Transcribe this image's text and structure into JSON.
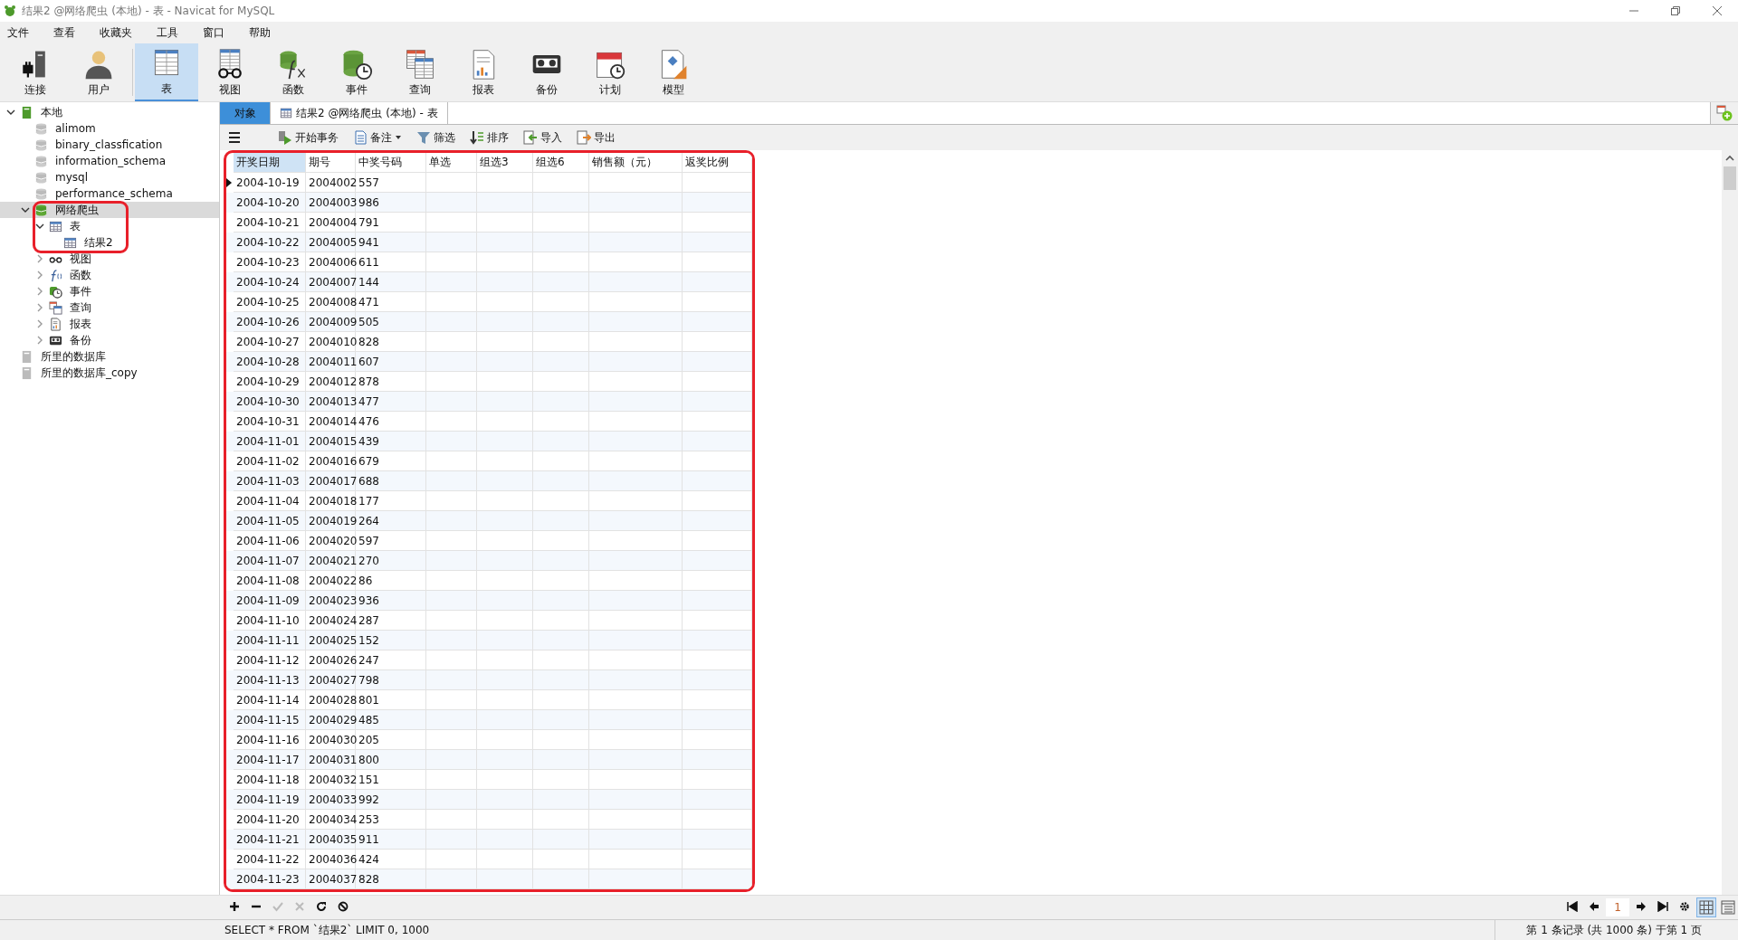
{
  "window": {
    "title": "结果2 @网络爬虫 (本地) - 表 - Navicat for MySQL"
  },
  "menu": [
    "文件",
    "查看",
    "收藏夹",
    "工具",
    "窗口",
    "帮助"
  ],
  "toolbar": [
    {
      "label": "连接",
      "selected": false
    },
    {
      "label": "用户",
      "selected": false
    },
    {
      "label": "表",
      "selected": true
    },
    {
      "label": "视图",
      "selected": false
    },
    {
      "label": "函数",
      "selected": false
    },
    {
      "label": "事件",
      "selected": false
    },
    {
      "label": "查询",
      "selected": false
    },
    {
      "label": "报表",
      "selected": false
    },
    {
      "label": "备份",
      "selected": false
    },
    {
      "label": "计划",
      "selected": false
    },
    {
      "label": "模型",
      "selected": false
    }
  ],
  "sidebar": {
    "tree": [
      {
        "label": "本地",
        "kind": "server",
        "open": true,
        "expanded": true,
        "selected": false,
        "children": [
          {
            "label": "alimom",
            "kind": "database",
            "open": false,
            "selected": false
          },
          {
            "label": "binary_classfication",
            "kind": "database",
            "open": false,
            "selected": false
          },
          {
            "label": "information_schema",
            "kind": "database",
            "open": false,
            "selected": false
          },
          {
            "label": "mysql",
            "kind": "database",
            "open": false,
            "selected": false
          },
          {
            "label": "performance_schema",
            "kind": "database",
            "open": false,
            "selected": false
          },
          {
            "label": "网络爬虫",
            "kind": "database",
            "open": true,
            "expanded": true,
            "selected": true,
            "children": [
              {
                "label": "表",
                "kind": "tables",
                "expanded": true,
                "selected": false,
                "children": [
                  {
                    "label": "结果2",
                    "kind": "table",
                    "selected": false
                  }
                ]
              },
              {
                "label": "视图",
                "kind": "views",
                "expanded": false,
                "selected": false
              },
              {
                "label": "函数",
                "kind": "functions",
                "expanded": false,
                "selected": false
              },
              {
                "label": "事件",
                "kind": "events",
                "expanded": false,
                "selected": false
              },
              {
                "label": "查询",
                "kind": "queries",
                "expanded": false,
                "selected": false
              },
              {
                "label": "报表",
                "kind": "reports",
                "expanded": false,
                "selected": false
              },
              {
                "label": "备份",
                "kind": "backups",
                "expanded": false,
                "selected": false
              }
            ]
          }
        ]
      },
      {
        "label": "所里的数据库",
        "kind": "server",
        "open": false,
        "selected": false
      },
      {
        "label": "所里的数据库_copy",
        "kind": "server",
        "open": false,
        "selected": false
      }
    ]
  },
  "tabs": [
    {
      "label": "对象",
      "selected": true
    },
    {
      "label": "结果2 @网络爬虫 (本地) - 表",
      "selected": false
    }
  ],
  "actions": [
    {
      "label": "开始事务",
      "dropdown": false
    },
    {
      "label": "备注",
      "dropdown": true
    },
    {
      "label": "筛选",
      "dropdown": false
    },
    {
      "label": "排序",
      "dropdown": false
    },
    {
      "label": "导入",
      "dropdown": false
    },
    {
      "label": "导出",
      "dropdown": false
    }
  ],
  "table": {
    "columns": [
      {
        "label": "开奖日期",
        "selected": true
      },
      {
        "label": "期号",
        "selected": false
      },
      {
        "label": "中奖号码",
        "selected": false
      },
      {
        "label": "单选",
        "selected": false
      },
      {
        "label": "组选3",
        "selected": false
      },
      {
        "label": "组选6",
        "selected": false
      },
      {
        "label": "销售额（元）",
        "selected": false
      },
      {
        "label": "返奖比例",
        "selected": false
      }
    ],
    "rows": [
      {
        "cells": [
          "2004-10-19",
          "2004002",
          "557"
        ],
        "current": true
      },
      {
        "cells": [
          "2004-10-20",
          "2004003",
          "986"
        ],
        "current": false
      },
      {
        "cells": [
          "2004-10-21",
          "2004004",
          "791"
        ],
        "current": false
      },
      {
        "cells": [
          "2004-10-22",
          "2004005",
          "941"
        ],
        "current": false
      },
      {
        "cells": [
          "2004-10-23",
          "2004006",
          "611"
        ],
        "current": false
      },
      {
        "cells": [
          "2004-10-24",
          "2004007",
          "144"
        ],
        "current": false
      },
      {
        "cells": [
          "2004-10-25",
          "2004008",
          "471"
        ],
        "current": false
      },
      {
        "cells": [
          "2004-10-26",
          "2004009",
          "505"
        ],
        "current": false
      },
      {
        "cells": [
          "2004-10-27",
          "2004010",
          "828"
        ],
        "current": false
      },
      {
        "cells": [
          "2004-10-28",
          "2004011",
          "607"
        ],
        "current": false
      },
      {
        "cells": [
          "2004-10-29",
          "2004012",
          "878"
        ],
        "current": false
      },
      {
        "cells": [
          "2004-10-30",
          "2004013",
          "477"
        ],
        "current": false
      },
      {
        "cells": [
          "2004-10-31",
          "2004014",
          "476"
        ],
        "current": false
      },
      {
        "cells": [
          "2004-11-01",
          "2004015",
          "439"
        ],
        "current": false
      },
      {
        "cells": [
          "2004-11-02",
          "2004016",
          "679"
        ],
        "current": false
      },
      {
        "cells": [
          "2004-11-03",
          "2004017",
          "688"
        ],
        "current": false
      },
      {
        "cells": [
          "2004-11-04",
          "2004018",
          "177"
        ],
        "current": false
      },
      {
        "cells": [
          "2004-11-05",
          "2004019",
          "264"
        ],
        "current": false
      },
      {
        "cells": [
          "2004-11-06",
          "2004020",
          "597"
        ],
        "current": false
      },
      {
        "cells": [
          "2004-11-07",
          "2004021",
          "270"
        ],
        "current": false
      },
      {
        "cells": [
          "2004-11-08",
          "2004022",
          "86"
        ],
        "current": false
      },
      {
        "cells": [
          "2004-11-09",
          "2004023",
          "936"
        ],
        "current": false
      },
      {
        "cells": [
          "2004-11-10",
          "2004024",
          "287"
        ],
        "current": false
      },
      {
        "cells": [
          "2004-11-11",
          "2004025",
          "152"
        ],
        "current": false
      },
      {
        "cells": [
          "2004-11-12",
          "2004026",
          "247"
        ],
        "current": false
      },
      {
        "cells": [
          "2004-11-13",
          "2004027",
          "798"
        ],
        "current": false
      },
      {
        "cells": [
          "2004-11-14",
          "2004028",
          "801"
        ],
        "current": false
      },
      {
        "cells": [
          "2004-11-15",
          "2004029",
          "485"
        ],
        "current": false
      },
      {
        "cells": [
          "2004-11-16",
          "2004030",
          "205"
        ],
        "current": false
      },
      {
        "cells": [
          "2004-11-17",
          "2004031",
          "800"
        ],
        "current": false
      },
      {
        "cells": [
          "2004-11-18",
          "2004032",
          "151"
        ],
        "current": false
      },
      {
        "cells": [
          "2004-11-19",
          "2004033",
          "992"
        ],
        "current": false
      },
      {
        "cells": [
          "2004-11-20",
          "2004034",
          "253"
        ],
        "current": false
      },
      {
        "cells": [
          "2004-11-21",
          "2004035",
          "911"
        ],
        "current": false
      },
      {
        "cells": [
          "2004-11-22",
          "2004036",
          "424"
        ],
        "current": false
      },
      {
        "cells": [
          "2004-11-23",
          "2004037",
          "828"
        ],
        "current": false
      }
    ]
  },
  "edit_buttons": [
    {
      "disabled": false
    },
    {
      "disabled": false
    },
    {
      "disabled": true
    },
    {
      "disabled": true
    },
    {
      "disabled": false
    },
    {
      "disabled": false
    }
  ],
  "pager": {
    "page": "1"
  },
  "view_buttons": [
    {
      "selected": true
    },
    {
      "selected": false
    }
  ],
  "status_bar": {
    "query": "SELECT * FROM `结果2` LIMIT 0, 1000",
    "records": "第 1 条记录 (共 1000 条) 于第 1 页"
  }
}
